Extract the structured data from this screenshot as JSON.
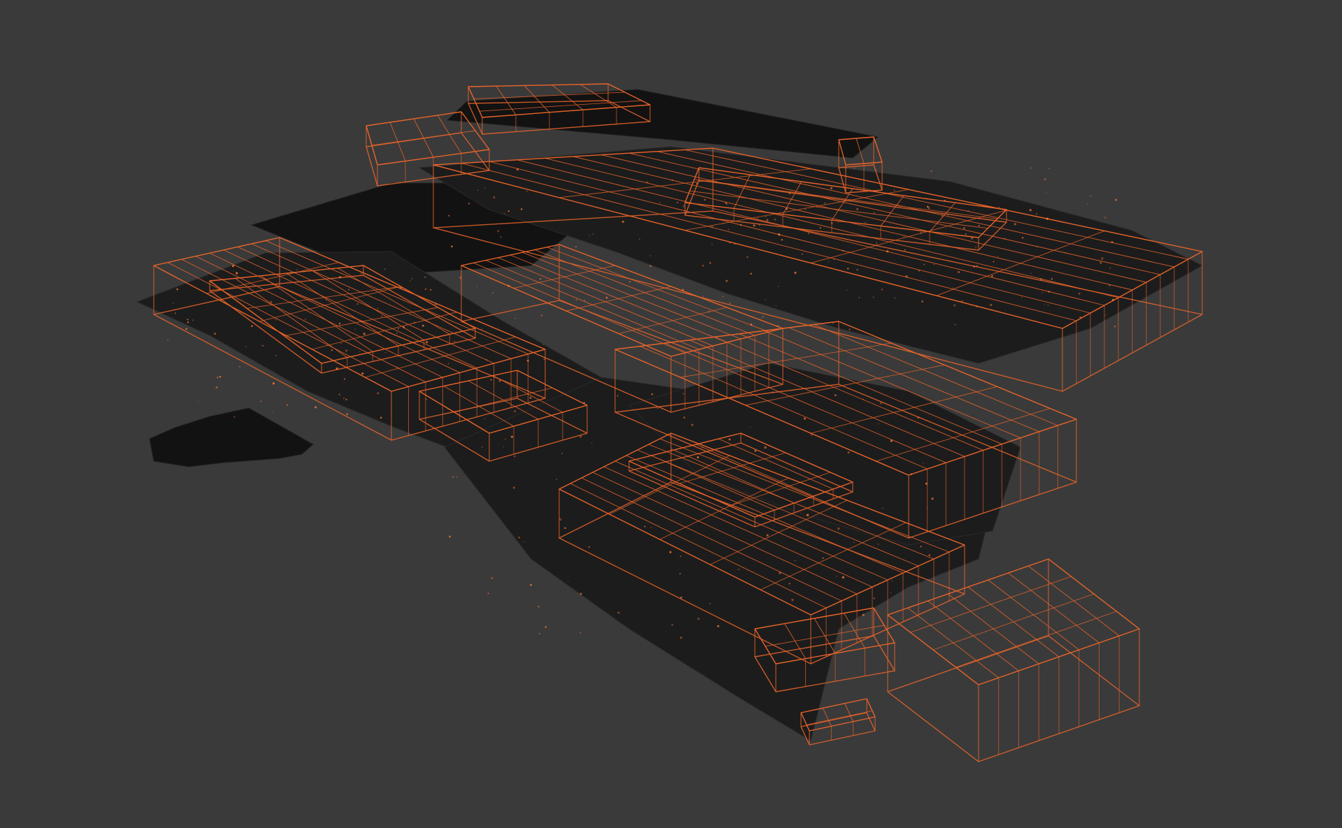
{
  "viewport": {
    "kind": "3d-point-cloud-viewer",
    "background_color": "#3a3a3a",
    "mesh_color": "#1c1c1c",
    "wireframe_color": "#e8642a",
    "point_highlight_color": "#ff7a33"
  },
  "scene_objects": [
    "point-cloud-scan",
    "building-wireframe-models",
    "isolated-mesh-fragment"
  ]
}
